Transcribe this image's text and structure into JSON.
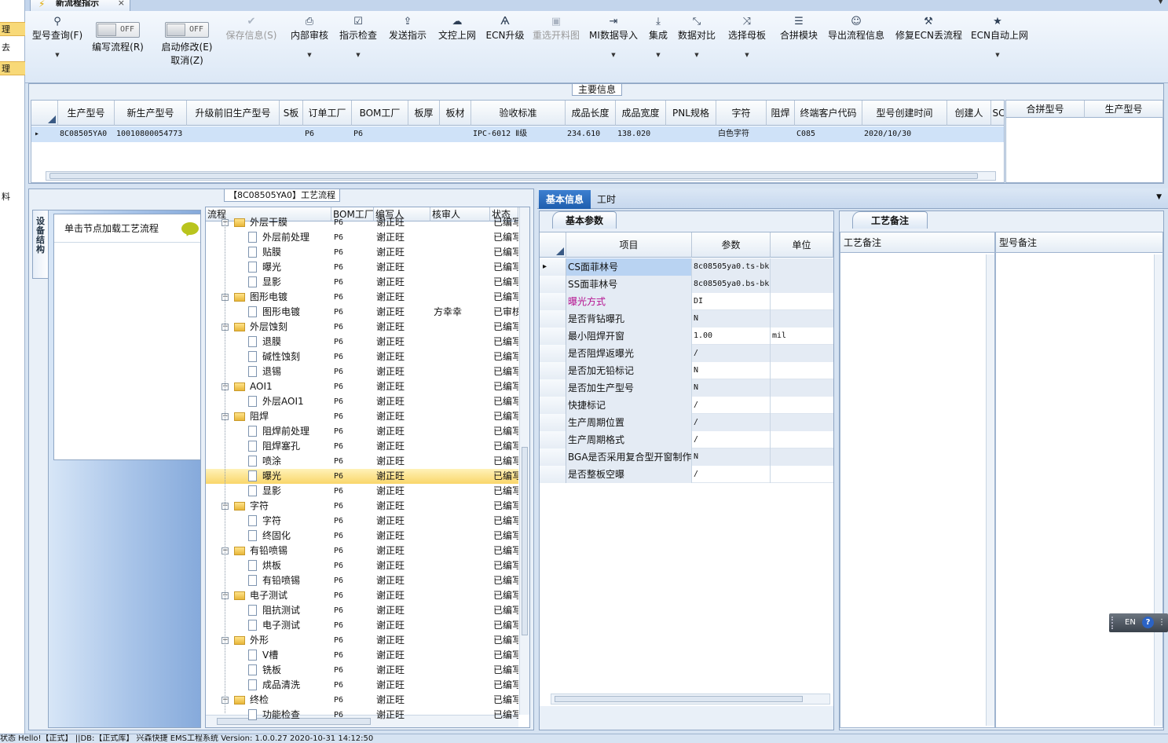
{
  "left_strip": {
    "items": [
      "理",
      "去",
      "理",
      "",
      "料"
    ]
  },
  "doc_tab": {
    "label": "新流程指示",
    "close": "×"
  },
  "ribbon": {
    "buttons": [
      {
        "id": "model-query",
        "icon": "search-icon",
        "glyph": "⚲",
        "label": "型号查询(F)",
        "dropdown": true,
        "disabled": false
      },
      {
        "id": "save-info",
        "icon": "check-icon",
        "glyph": "✔",
        "label": "保存信息(S)",
        "dropdown": false,
        "disabled": true
      },
      {
        "id": "internal-review",
        "icon": "printer-icon",
        "glyph": "⎙",
        "label": "内部审核",
        "dropdown": true,
        "disabled": false
      },
      {
        "id": "instruction-check",
        "icon": "checkbox-icon",
        "glyph": "☑",
        "label": "指示检查",
        "dropdown": true,
        "disabled": false
      },
      {
        "id": "send-instruction",
        "icon": "upload-icon",
        "glyph": "⇪",
        "label": "发送指示",
        "dropdown": false,
        "disabled": false
      },
      {
        "id": "doc-control-upload",
        "icon": "cloud-upload-icon",
        "glyph": "☁",
        "label": "文控上网",
        "dropdown": false,
        "disabled": false
      },
      {
        "id": "ecn-upgrade",
        "icon": "ecn-icon",
        "glyph": "Ѧ",
        "label": "ECN升级",
        "dropdown": false,
        "disabled": false
      },
      {
        "id": "reselect-cut-drawing",
        "icon": "image-icon",
        "glyph": "▣",
        "label": "重选开料图",
        "dropdown": false,
        "disabled": true
      },
      {
        "id": "mi-data-import",
        "icon": "import-icon",
        "glyph": "⇥",
        "label": "MI数据导入",
        "dropdown": true,
        "disabled": false
      },
      {
        "id": "integrate",
        "icon": "download-icon",
        "glyph": "⤓",
        "label": "集成",
        "dropdown": true,
        "disabled": false
      },
      {
        "id": "data-compare",
        "icon": "compare-icon",
        "glyph": "⤡",
        "label": "数据对比",
        "dropdown": true,
        "disabled": false
      },
      {
        "id": "select-master",
        "icon": "shuffle-icon",
        "glyph": "⤨",
        "label": "选择母板",
        "dropdown": true,
        "disabled": false
      },
      {
        "id": "merge-module",
        "icon": "list-icon",
        "glyph": "☰",
        "label": "合拼模块",
        "dropdown": false,
        "disabled": false
      },
      {
        "id": "export-flow-info",
        "icon": "smiley-icon",
        "glyph": "☺",
        "label": "导出流程信息",
        "dropdown": false,
        "disabled": false
      },
      {
        "id": "repair-ecn-flow",
        "icon": "wrench-icon",
        "glyph": "⚒",
        "label": "修复ECN丢流程",
        "dropdown": false,
        "disabled": false
      },
      {
        "id": "ecn-auto-upload",
        "icon": "star-icon",
        "glyph": "★",
        "label": "ECN自动上网",
        "dropdown": true,
        "disabled": false
      }
    ],
    "toggles": [
      {
        "label": "编写流程(R)",
        "value": "OFF"
      },
      {
        "label": "启动修改(E)",
        "label2": "取消(Z)",
        "value": "OFF"
      }
    ]
  },
  "main_info": {
    "title": "主要信息",
    "columns": [
      "生产型号",
      "新生产型号",
      "升级前旧生产型号",
      "S板",
      "订单工厂",
      "BOM工厂",
      "板厚",
      "板材",
      "验收标准",
      "成品长度",
      "成品宽度",
      "PNL规格",
      "字符",
      "阻焊",
      "终端客户代码",
      "型号创建时间",
      "创建人",
      "SC"
    ],
    "row": [
      "8C08505YA0",
      "10010800054773",
      "",
      "",
      "P6",
      "P6",
      "",
      "",
      "IPC-6012 Ⅱ级",
      "234.610",
      "138.020",
      "",
      "白色字符",
      "",
      "C085",
      "2020/10/30",
      "",
      ""
    ],
    "merge_columns": [
      "合拼型号",
      "生产型号"
    ]
  },
  "process": {
    "title": "【8C08505YA0】工艺流程",
    "side_tab": "设备结构",
    "node_hint": "单击节点加载工艺流程",
    "columns": [
      "流程",
      "BOM工厂",
      "编写人",
      "核审人",
      "状态"
    ],
    "rows": [
      {
        "name": "外层干膜",
        "level": 1,
        "bom": "P6",
        "writer": "谢正旺",
        "reviewer": "",
        "status": "已编写"
      },
      {
        "name": "外层前处理",
        "level": 2,
        "bom": "P6",
        "writer": "谢正旺",
        "reviewer": "",
        "status": "已编写"
      },
      {
        "name": "贴膜",
        "level": 2,
        "bom": "P6",
        "writer": "谢正旺",
        "reviewer": "",
        "status": "已编写"
      },
      {
        "name": "曝光",
        "level": 2,
        "bom": "P6",
        "writer": "谢正旺",
        "reviewer": "",
        "status": "已编写"
      },
      {
        "name": "显影",
        "level": 2,
        "bom": "P6",
        "writer": "谢正旺",
        "reviewer": "",
        "status": "已编写"
      },
      {
        "name": "图形电镀",
        "level": 1,
        "bom": "P6",
        "writer": "谢正旺",
        "reviewer": "",
        "status": "已编写"
      },
      {
        "name": "图形电镀",
        "level": 2,
        "bom": "P6",
        "writer": "谢正旺",
        "reviewer": "方幸幸",
        "status": "已审核"
      },
      {
        "name": "外层蚀刻",
        "level": 1,
        "bom": "P6",
        "writer": "谢正旺",
        "reviewer": "",
        "status": "已编写"
      },
      {
        "name": "退膜",
        "level": 2,
        "bom": "P6",
        "writer": "谢正旺",
        "reviewer": "",
        "status": "已编写"
      },
      {
        "name": "碱性蚀刻",
        "level": 2,
        "bom": "P6",
        "writer": "谢正旺",
        "reviewer": "",
        "status": "已编写"
      },
      {
        "name": "退锡",
        "level": 2,
        "bom": "P6",
        "writer": "谢正旺",
        "reviewer": "",
        "status": "已编写"
      },
      {
        "name": "AOI1",
        "level": 1,
        "bom": "P6",
        "writer": "谢正旺",
        "reviewer": "",
        "status": "已编写"
      },
      {
        "name": "外层AOI1",
        "level": 2,
        "bom": "P6",
        "writer": "谢正旺",
        "reviewer": "",
        "status": "已编写"
      },
      {
        "name": "阻焊",
        "level": 1,
        "bom": "P6",
        "writer": "谢正旺",
        "reviewer": "",
        "status": "已编写"
      },
      {
        "name": "阻焊前处理",
        "level": 2,
        "bom": "P6",
        "writer": "谢正旺",
        "reviewer": "",
        "status": "已编写"
      },
      {
        "name": "阻焊塞孔",
        "level": 2,
        "bom": "P6",
        "writer": "谢正旺",
        "reviewer": "",
        "status": "已编写"
      },
      {
        "name": "喷涂",
        "level": 2,
        "bom": "P6",
        "writer": "谢正旺",
        "reviewer": "",
        "status": "已编写"
      },
      {
        "name": "曝光",
        "level": 2,
        "bom": "P6",
        "writer": "谢正旺",
        "reviewer": "",
        "status": "已编写",
        "selected": true
      },
      {
        "name": "显影",
        "level": 2,
        "bom": "P6",
        "writer": "谢正旺",
        "reviewer": "",
        "status": "已编写"
      },
      {
        "name": "字符",
        "level": 1,
        "bom": "P6",
        "writer": "谢正旺",
        "reviewer": "",
        "status": "已编写"
      },
      {
        "name": "字符",
        "level": 2,
        "bom": "P6",
        "writer": "谢正旺",
        "reviewer": "",
        "status": "已编写"
      },
      {
        "name": "终固化",
        "level": 2,
        "bom": "P6",
        "writer": "谢正旺",
        "reviewer": "",
        "status": "已编写"
      },
      {
        "name": "有铅喷锡",
        "level": 1,
        "bom": "P6",
        "writer": "谢正旺",
        "reviewer": "",
        "status": "已编写"
      },
      {
        "name": "烘板",
        "level": 2,
        "bom": "P6",
        "writer": "谢正旺",
        "reviewer": "",
        "status": "已编写"
      },
      {
        "name": "有铅喷锡",
        "level": 2,
        "bom": "P6",
        "writer": "谢正旺",
        "reviewer": "",
        "status": "已编写"
      },
      {
        "name": "电子测试",
        "level": 1,
        "bom": "P6",
        "writer": "谢正旺",
        "reviewer": "",
        "status": "已编写"
      },
      {
        "name": "阻抗测试",
        "level": 2,
        "bom": "P6",
        "writer": "谢正旺",
        "reviewer": "",
        "status": "已编写"
      },
      {
        "name": "电子测试",
        "level": 2,
        "bom": "P6",
        "writer": "谢正旺",
        "reviewer": "",
        "status": "已编写"
      },
      {
        "name": "外形",
        "level": 1,
        "bom": "P6",
        "writer": "谢正旺",
        "reviewer": "",
        "status": "已编写"
      },
      {
        "name": "V槽",
        "level": 2,
        "bom": "P6",
        "writer": "谢正旺",
        "reviewer": "",
        "status": "已编写"
      },
      {
        "name": "铣板",
        "level": 2,
        "bom": "P6",
        "writer": "谢正旺",
        "reviewer": "",
        "status": "已编写"
      },
      {
        "name": "成品清洗",
        "level": 2,
        "bom": "P6",
        "writer": "谢正旺",
        "reviewer": "",
        "status": "已编写"
      },
      {
        "name": "终检",
        "level": 1,
        "bom": "P6",
        "writer": "谢正旺",
        "reviewer": "",
        "status": "已编写"
      },
      {
        "name": "功能检查",
        "level": 2,
        "bom": "P6",
        "writer": "谢正旺",
        "reviewer": "",
        "status": "已编写"
      }
    ]
  },
  "right_tabs": {
    "basic": "基本信息",
    "hours": "工时"
  },
  "params": {
    "group_title": "基本参数",
    "columns": [
      "项目",
      "参数",
      "单位"
    ],
    "rows": [
      {
        "item": "CS面菲林号",
        "value": "8c08505ya0.ts-bk",
        "unit": ""
      },
      {
        "item": "SS面菲林号",
        "value": "8c08505ya0.bs-bk",
        "unit": ""
      },
      {
        "item": "曝光方式",
        "value": "DI",
        "unit": "",
        "highlight": true
      },
      {
        "item": "是否背钻曝孔",
        "value": "N",
        "unit": ""
      },
      {
        "item": "最小阻焊开窗",
        "value": "1.00",
        "unit": "mil"
      },
      {
        "item": "是否阻焊返曝光",
        "value": "/",
        "unit": ""
      },
      {
        "item": "是否加无铅标记",
        "value": "N",
        "unit": ""
      },
      {
        "item": "是否加生产型号",
        "value": "N",
        "unit": ""
      },
      {
        "item": "快捷标记",
        "value": "/",
        "unit": ""
      },
      {
        "item": "生产周期位置",
        "value": "/",
        "unit": ""
      },
      {
        "item": "生产周期格式",
        "value": "/",
        "unit": ""
      },
      {
        "item": "BGA是否采用复合型开窗制作",
        "value": "N",
        "unit": ""
      },
      {
        "item": "是否整板空曝",
        "value": "/",
        "unit": ""
      }
    ]
  },
  "notes": {
    "group_title": "工艺备注",
    "craft_note": "工艺备注",
    "model_note": "型号备注"
  },
  "statusbar": {
    "text": "状态  Hello!【正式】 ||DB:【正式库】                              兴森快捷 EMS工程系统 Version: 1.0.0.27                                                                               2020-10-31 14:12:50"
  },
  "ime": {
    "lang": "EN",
    "help": "?"
  }
}
